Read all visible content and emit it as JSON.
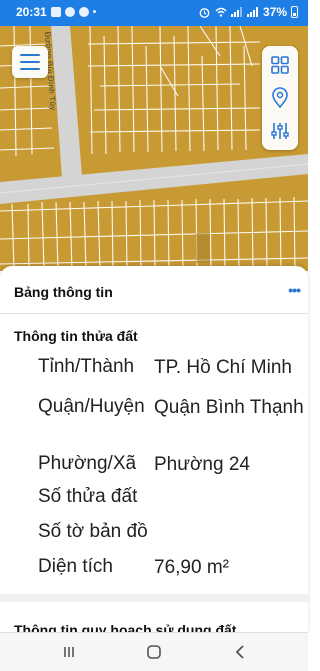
{
  "status_bar": {
    "time": "20:31",
    "battery": "37%"
  },
  "map": {
    "road_label": "Đường Bùi Đình Túy",
    "land_color": "#c79a33",
    "road_color": "#d4d4d4"
  },
  "controls": {
    "menu": "menu-icon",
    "tools": [
      "grid-icon",
      "location-pin-icon",
      "sliders-icon"
    ]
  },
  "sheet": {
    "title": "Bảng thông tin",
    "section_title": "Thông tin thửa đất",
    "rows": [
      {
        "label": "Tỉnh/Thành",
        "value": "TP. Hồ Chí Minh"
      },
      {
        "label": "Quận/Huyện",
        "value": "Quận Bình Thạnh"
      },
      {
        "label": "Phường/Xã",
        "value": "Phường 24"
      },
      {
        "label": "Số thửa đất",
        "value": ""
      },
      {
        "label": "Số tờ bản đồ",
        "value": ""
      },
      {
        "label": "Diện tích",
        "value": "76,90 m²"
      }
    ],
    "next_section": "Thông tin quy hoạch sử dụng đất"
  },
  "accent_color": "#2b78d4"
}
